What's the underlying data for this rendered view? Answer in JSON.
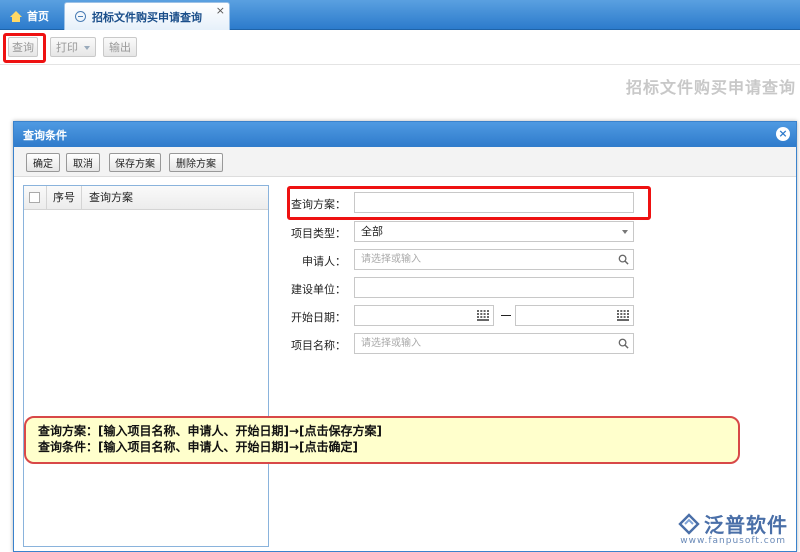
{
  "tabs": {
    "home": "首页",
    "active": "招标文件购买申请查询",
    "close": "×"
  },
  "toolbar": {
    "query": "查询",
    "print": "打印",
    "export": "输出"
  },
  "page_title": "招标文件购买申请查询",
  "dialog": {
    "title": "查询条件",
    "close": "×",
    "buttons": {
      "confirm": "确定",
      "cancel": "取消",
      "save_scheme": "保存方案",
      "delete_scheme": "删除方案"
    },
    "scheme_table": {
      "col_index": "序号",
      "col_scheme": "查询方案"
    },
    "form": {
      "scheme": {
        "label": "查询方案：",
        "value": ""
      },
      "project_type": {
        "label": "项目类型：",
        "value": "全部"
      },
      "applicant": {
        "label": "申请人：",
        "placeholder": "请选择或输入"
      },
      "build_unit": {
        "label": "建设单位：",
        "value": ""
      },
      "start_date": {
        "label": "开始日期：",
        "from": "",
        "to": "",
        "separator": "—"
      },
      "project_name": {
        "label": "项目名称：",
        "placeholder": "请选择或输入"
      }
    }
  },
  "annotation": {
    "line1": "查询方案：[输入项目名称、申请人、开始日期]→[点击保存方案]",
    "line2": "查询条件：[输入项目名称、申请人、开始日期]→[点击确定]"
  },
  "logo": {
    "name": "泛普软件",
    "url_text": "www.fanpusoft.com"
  },
  "colors": {
    "header_blue": "#2f7bcb",
    "highlight_red": "#e11111",
    "callout_bg": "#ffffcc"
  }
}
